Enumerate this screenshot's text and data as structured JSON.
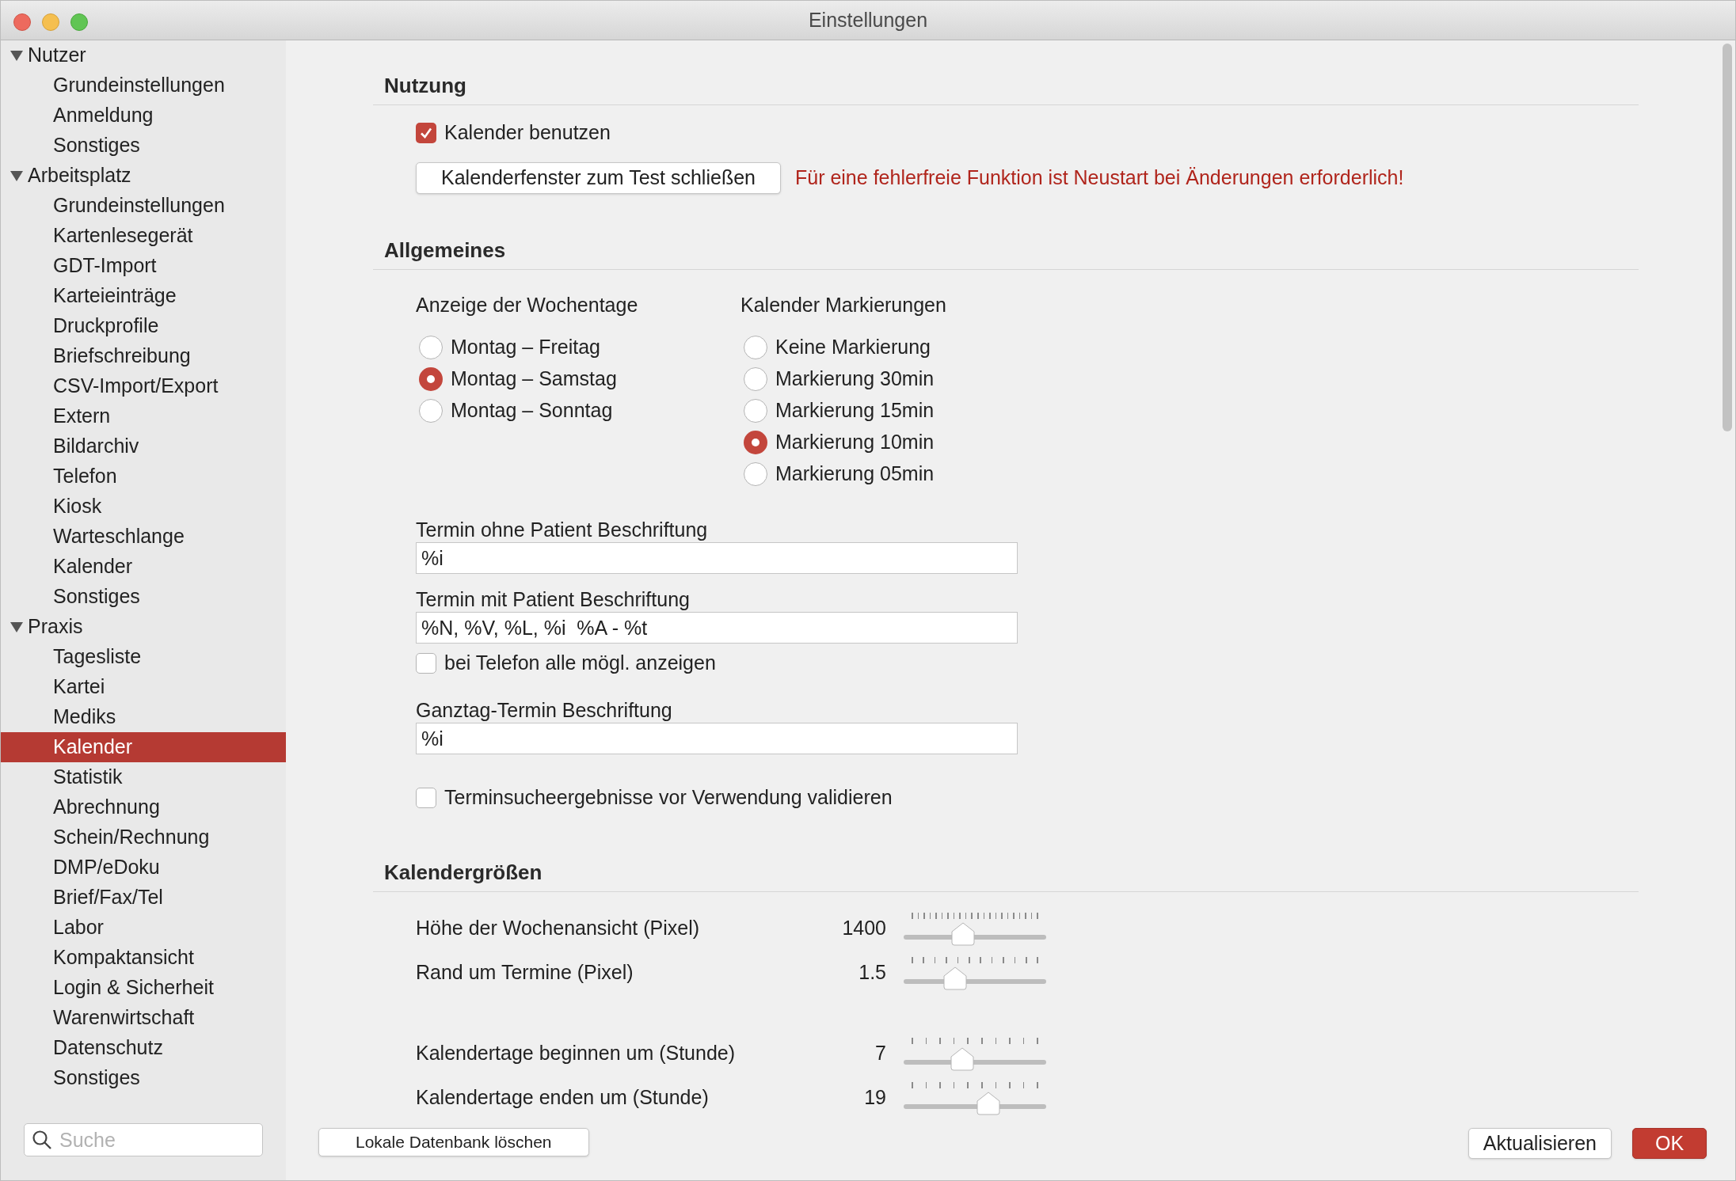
{
  "window": {
    "title": "Einstellungen"
  },
  "sidebar": {
    "groups": [
      {
        "label": "Nutzer",
        "expanded": true,
        "children": [
          {
            "label": "Grundeinstellungen",
            "selected": false
          },
          {
            "label": "Anmeldung",
            "selected": false
          },
          {
            "label": "Sonstiges",
            "selected": false
          }
        ]
      },
      {
        "label": "Arbeitsplatz",
        "expanded": true,
        "children": [
          {
            "label": "Grundeinstellungen",
            "selected": false
          },
          {
            "label": "Kartenlesegerät",
            "selected": false
          },
          {
            "label": "GDT-Import",
            "selected": false
          },
          {
            "label": "Karteieinträge",
            "selected": false
          },
          {
            "label": "Druckprofile",
            "selected": false
          },
          {
            "label": "Briefschreibung",
            "selected": false
          },
          {
            "label": "CSV-Import/Export",
            "selected": false
          },
          {
            "label": "Extern",
            "selected": false
          },
          {
            "label": "Bildarchiv",
            "selected": false
          },
          {
            "label": "Telefon",
            "selected": false
          },
          {
            "label": "Kiosk",
            "selected": false
          },
          {
            "label": "Warteschlange",
            "selected": false
          },
          {
            "label": "Kalender",
            "selected": false
          },
          {
            "label": "Sonstiges",
            "selected": false
          }
        ]
      },
      {
        "label": "Praxis",
        "expanded": true,
        "children": [
          {
            "label": "Tagesliste",
            "selected": false
          },
          {
            "label": "Kartei",
            "selected": false
          },
          {
            "label": "Mediks",
            "selected": false
          },
          {
            "label": "Kalender",
            "selected": true
          },
          {
            "label": "Statistik",
            "selected": false
          },
          {
            "label": "Abrechnung",
            "selected": false
          },
          {
            "label": "Schein/Rechnung",
            "selected": false
          },
          {
            "label": "DMP/eDoku",
            "selected": false
          },
          {
            "label": "Brief/Fax/Tel",
            "selected": false
          },
          {
            "label": "Labor",
            "selected": false
          },
          {
            "label": "Kompaktansicht",
            "selected": false
          },
          {
            "label": "Login & Sicherheit",
            "selected": false
          },
          {
            "label": "Warenwirtschaft",
            "selected": false
          },
          {
            "label": "Datenschutz",
            "selected": false
          },
          {
            "label": "Sonstiges",
            "selected": false
          }
        ]
      }
    ]
  },
  "search": {
    "placeholder": "Suche"
  },
  "nutzung": {
    "title": "Nutzung",
    "checkbox": {
      "label": "Kalender benutzen",
      "checked": true
    },
    "button": "Kalenderfenster zum Test schließen",
    "warning": "Für eine fehlerfreie Funktion ist Neustart bei Änderungen erforderlich!"
  },
  "allgemeines": {
    "title": "Allgemeines",
    "radio_groups": [
      {
        "title": "Anzeige der Wochentage",
        "options": [
          {
            "label": "Montag – Freitag",
            "selected": false
          },
          {
            "label": "Montag – Samstag",
            "selected": true
          },
          {
            "label": "Montag – Sonntag",
            "selected": false
          }
        ]
      },
      {
        "title": "Kalender Markierungen",
        "options": [
          {
            "label": "Keine Markierung",
            "selected": false
          },
          {
            "label": "Markierung 30min",
            "selected": false
          },
          {
            "label": "Markierung 15min",
            "selected": false
          },
          {
            "label": "Markierung 10min",
            "selected": true
          },
          {
            "label": "Markierung 05min",
            "selected": false
          }
        ]
      }
    ],
    "items": [
      {
        "kind": "field",
        "label": "Termin ohne Patient Beschriftung",
        "value": "%i"
      },
      {
        "kind": "field",
        "label": "Termin mit Patient Beschriftung",
        "value": "%N, %V, %L, %i  %A - %t"
      },
      {
        "kind": "checkbox",
        "label": "bei Telefon alle mögl. anzeigen",
        "checked": false
      },
      {
        "kind": "field",
        "label": "Ganztag-Termin Beschriftung",
        "value": "%i"
      },
      {
        "kind": "checkbox",
        "label": "Terminsucheergebnisse vor Verwendung validieren",
        "checked": false
      }
    ]
  },
  "kalendergroessen": {
    "title": "Kalendergrößen",
    "slider_groups": [
      [
        {
          "label": "Höhe der Wochenansicht (Pixel)",
          "reading": "1400",
          "level": 0.4
        },
        {
          "label": "Rand um Termine (Pixel)",
          "reading": "1.5",
          "level": 0.33
        }
      ],
      [
        {
          "label": "Kalendertage beginnen um (Stunde)",
          "reading": "7",
          "level": 0.39
        },
        {
          "label": "Kalendertage enden um (Stunde)",
          "reading": "19",
          "level": 0.61
        }
      ]
    ]
  },
  "buttons": [
    {
      "kind": "plain",
      "label": "Lokale Datenbank löschen"
    },
    {
      "kind": "secondary",
      "label": "Aktualisieren"
    },
    {
      "kind": "default",
      "label": "OK"
    }
  ]
}
